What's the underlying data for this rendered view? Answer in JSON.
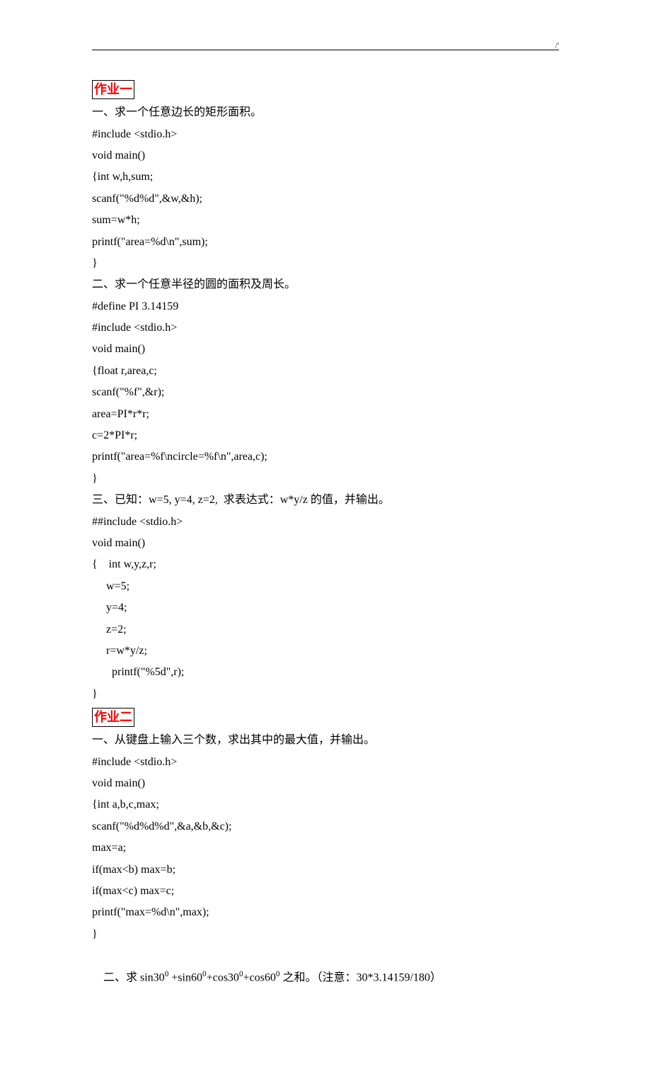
{
  "topNote": "/'",
  "heading1": "作业一",
  "s1": {
    "q1_title": "一、求一个任意边长的矩形面积。",
    "q1_l1": "#include <stdio.h>",
    "q1_l2": "void main()",
    "q1_l3": "{int w,h,sum;",
    "q1_l4": "scanf(\"%d%d\",&w,&h);",
    "q1_l5": "sum=w*h;",
    "q1_l6": "printf(\"area=%d\\n\",sum);",
    "q1_l7": "}",
    "q2_title": "二、求一个任意半径的圆的面积及周长。",
    "q2_l1": "#define PI 3.14159",
    "q2_l2": "#include <stdio.h>",
    "q2_l3": "void main()",
    "q2_l4": "{float r,area,c;",
    "q2_l5": "scanf(\"%f\",&r);",
    "q2_l6": "area=PI*r*r;",
    "q2_l7": "c=2*PI*r;",
    "q2_l8": "printf(\"area=%f\\ncircle=%f\\n\",area,c);",
    "q2_l9": "}",
    "q3_title": "三、已知：w=5, y=4, z=2,  求表达式：w*y/z 的值，并输出。",
    "q3_l1": "##include <stdio.h>",
    "q3_l2": "void main()",
    "q3_l3": "{    int w,y,z,r;",
    "q3_l4": "",
    "q3_l5": "     w=5;",
    "q3_l6": "     y=4;",
    "q3_l7": "     z=2;",
    "q3_l8": "     r=w*y/z;",
    "q3_l9": "       printf(\"%5d\",r);",
    "q3_l10": "}"
  },
  "heading2": "作业二",
  "s2": {
    "q1_title": "一、从键盘上输入三个数，求出其中的最大值，并输出。",
    "q1_l1": "#include <stdio.h>",
    "q1_l2": "void main()",
    "q1_l3": "{int a,b,c,max;",
    "q1_l4": "scanf(\"%d%d%d\",&a,&b,&c);",
    "q1_l5": "max=a;",
    "q1_l6": "if(max<b) max=b;",
    "q1_l7": "if(max<c) max=c;",
    "q1_l8": "printf(\"max=%d\\n\",max);",
    "q1_l9": "}",
    "q2_pre": "二、求 sin30",
    "q2_mid1": " +sin60",
    "q2_mid2": "+cos30",
    "q2_mid3": "+cos60",
    "q2_post": " 之和。（注意：30*3.14159/180）",
    "deg": "0"
  }
}
